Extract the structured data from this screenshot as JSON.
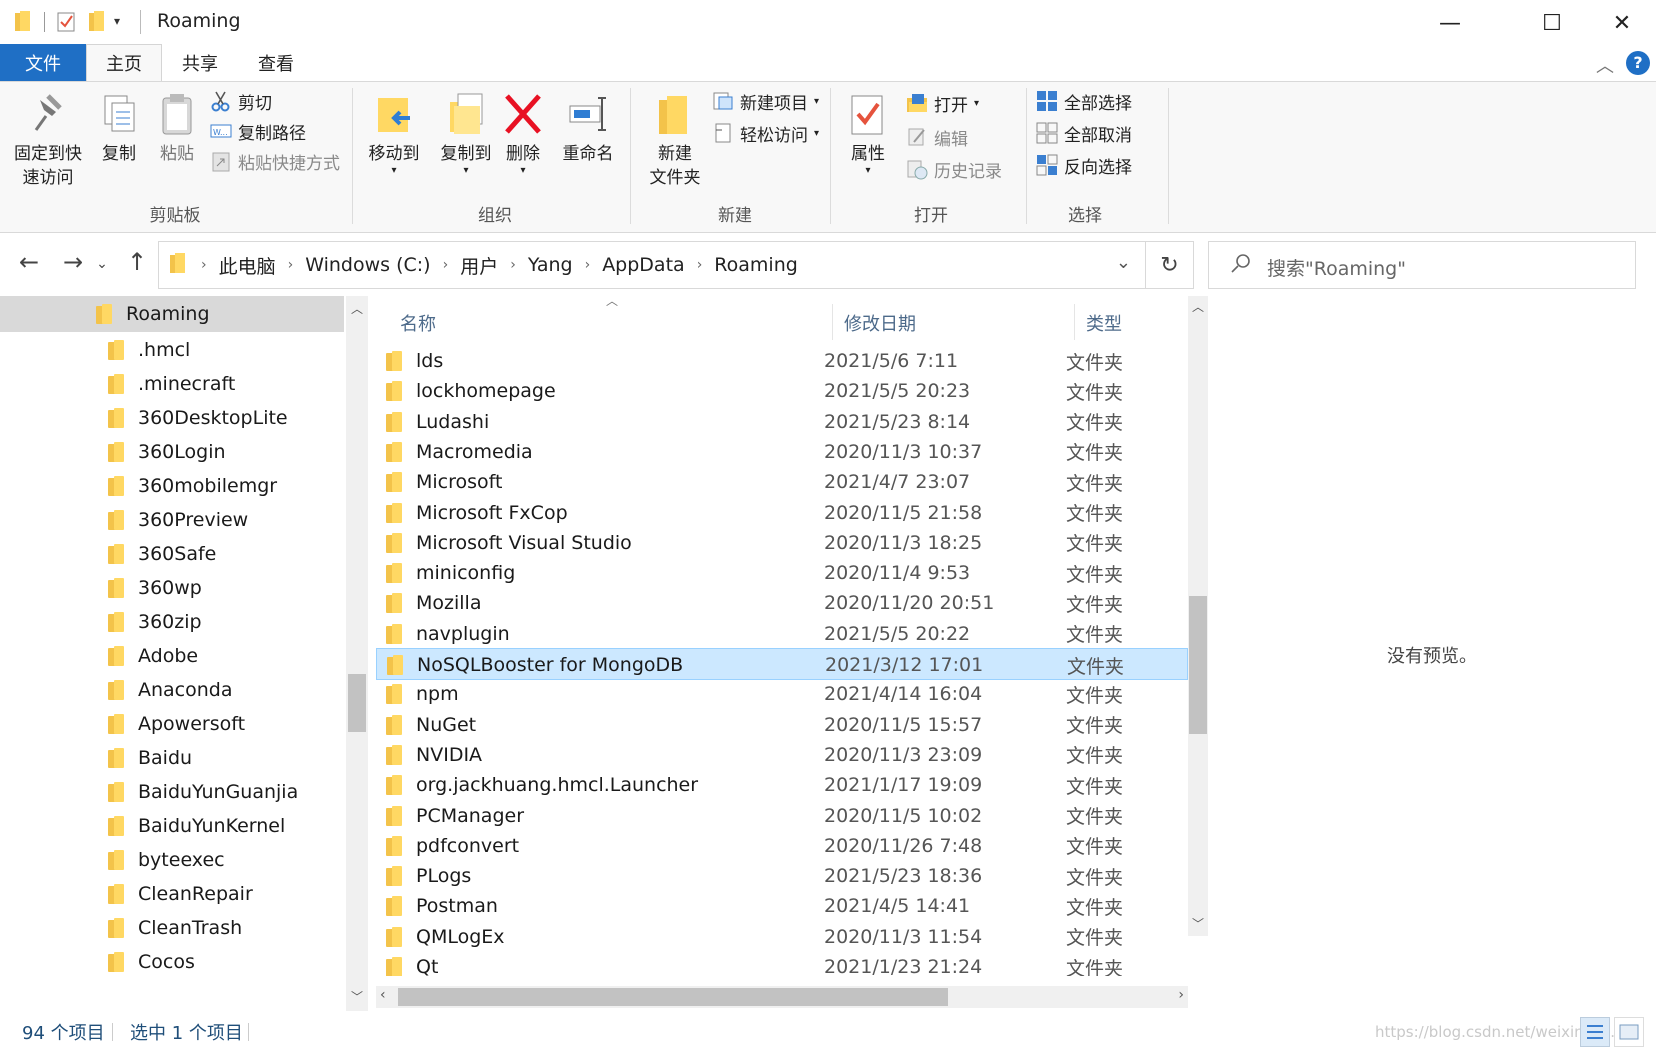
{
  "window": {
    "title": "Roaming",
    "minimize": "—",
    "maximize": "☐",
    "close": "✕"
  },
  "tabs": [
    {
      "label": "文件"
    },
    {
      "label": "主页"
    },
    {
      "label": "共享"
    },
    {
      "label": "查看"
    }
  ],
  "ribbon": {
    "clipboard": {
      "label": "剪贴板",
      "pin_line1": "固定到快",
      "pin_line2": "速访问",
      "copy": "复制",
      "paste": "粘贴",
      "cut": "剪切",
      "copy_path": "复制路径",
      "paste_shortcut": "粘贴快捷方式"
    },
    "organize": {
      "label": "组织",
      "move_to": "移动到",
      "copy_to": "复制到",
      "delete": "删除",
      "rename": "重命名"
    },
    "new": {
      "label": "新建",
      "new_folder_line1": "新建",
      "new_folder_line2": "文件夹",
      "new_item": "新建项目",
      "easy_access": "轻松访问"
    },
    "open": {
      "label": "打开",
      "properties": "属性",
      "open": "打开",
      "edit": "编辑",
      "history": "历史记录"
    },
    "select": {
      "label": "选择",
      "select_all": "全部选择",
      "select_none": "全部取消",
      "invert": "反向选择"
    }
  },
  "address": {
    "crumbs": [
      "此电脑",
      "Windows (C:)",
      "用户",
      "Yang",
      "AppData",
      "Roaming"
    ],
    "search_placeholder": "搜索\"Roaming\""
  },
  "nav": {
    "items": [
      "Roaming",
      ".hmcl",
      ".minecraft",
      "360DesktopLite",
      "360Login",
      "360mobilemgr",
      "360Preview",
      "360Safe",
      "360wp",
      "360zip",
      "Adobe",
      "Anaconda",
      "Apowersoft",
      "Baidu",
      "BaiduYunGuanjia",
      "BaiduYunKernel",
      "byteexec",
      "CleanRepair",
      "CleanTrash",
      "Cocos"
    ]
  },
  "list": {
    "columns": {
      "name": "名称",
      "date": "修改日期",
      "type": "类型"
    },
    "rows": [
      {
        "name": "lds",
        "date": "2021/5/6 7:11",
        "type": "文件夹"
      },
      {
        "name": "lockhomepage",
        "date": "2021/5/5 20:23",
        "type": "文件夹"
      },
      {
        "name": "Ludashi",
        "date": "2021/5/23 8:14",
        "type": "文件夹"
      },
      {
        "name": "Macromedia",
        "date": "2020/11/3 10:37",
        "type": "文件夹"
      },
      {
        "name": "Microsoft",
        "date": "2021/4/7 23:07",
        "type": "文件夹"
      },
      {
        "name": "Microsoft FxCop",
        "date": "2020/11/5 21:58",
        "type": "文件夹"
      },
      {
        "name": "Microsoft Visual Studio",
        "date": "2020/11/3 18:25",
        "type": "文件夹"
      },
      {
        "name": "miniconfig",
        "date": "2020/11/4 9:53",
        "type": "文件夹"
      },
      {
        "name": "Mozilla",
        "date": "2020/11/20 20:51",
        "type": "文件夹"
      },
      {
        "name": "navplugin",
        "date": "2021/5/5 20:22",
        "type": "文件夹"
      },
      {
        "name": "NoSQLBooster for MongoDB",
        "date": "2021/3/12 17:01",
        "type": "文件夹"
      },
      {
        "name": "npm",
        "date": "2021/4/14 16:04",
        "type": "文件夹"
      },
      {
        "name": "NuGet",
        "date": "2020/11/5 15:57",
        "type": "文件夹"
      },
      {
        "name": "NVIDIA",
        "date": "2020/11/3 23:09",
        "type": "文件夹"
      },
      {
        "name": "org.jackhuang.hmcl.Launcher",
        "date": "2021/1/17 19:09",
        "type": "文件夹"
      },
      {
        "name": "PCManager",
        "date": "2020/11/5 10:02",
        "type": "文件夹"
      },
      {
        "name": "pdfconvert",
        "date": "2020/11/26 7:48",
        "type": "文件夹"
      },
      {
        "name": "PLogs",
        "date": "2021/5/23 18:36",
        "type": "文件夹"
      },
      {
        "name": "Postman",
        "date": "2021/4/5 14:41",
        "type": "文件夹"
      },
      {
        "name": "QMLogEx",
        "date": "2020/11/3 11:54",
        "type": "文件夹"
      },
      {
        "name": "Qt",
        "date": "2021/1/23 21:24",
        "type": "文件夹"
      }
    ],
    "selected_index": 10
  },
  "preview": {
    "message": "没有预览。"
  },
  "status": {
    "item_count": "94 个项目",
    "selected": "选中 1 个项目",
    "watermark": "https://blog.csdn.net/weixin_4..."
  },
  "colors": {
    "file_tab": "#1f6fc5",
    "selection": "#cce8ff",
    "folder": "#ffd863",
    "delete": "#e81123"
  }
}
